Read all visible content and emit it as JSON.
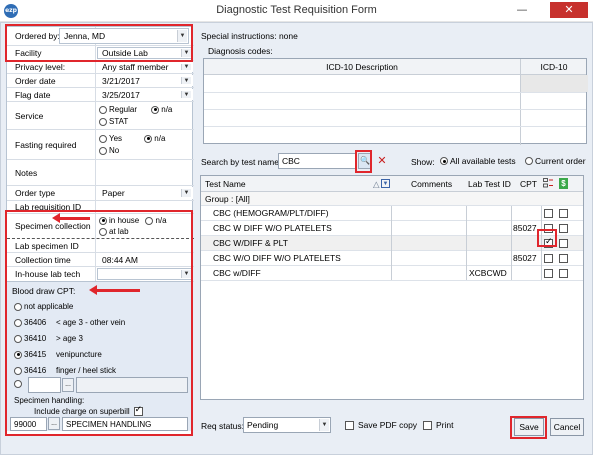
{
  "window": {
    "app_icon": "ezp",
    "title": "Diagnostic Test Requisition Form",
    "minimize_icon": "—",
    "close_icon": "✕"
  },
  "form": {
    "ordered_by_label": "Ordered by:",
    "ordered_by_value": "Jenna, MD",
    "facility_label": "Facility",
    "facility_value": "Outside Lab",
    "privacy_label": "Privacy level:",
    "privacy_value": "Any staff member",
    "order_date_label": "Order date",
    "order_date_value": "3/21/2017",
    "flag_date_label": "Flag date",
    "flag_date_value": "3/25/2017",
    "service_label": "Service",
    "service_options": [
      "Regular",
      "n/a",
      "STAT"
    ],
    "fasting_label": "Fasting required",
    "fasting_options": [
      "Yes",
      "n/a",
      "No"
    ],
    "notes_label": "Notes",
    "order_type_label": "Order type",
    "order_type_value": "Paper",
    "lab_req_label": "Lab requisition ID",
    "specimen_collection_label": "Specimen collection",
    "specimen_options": [
      "in house",
      "n/a",
      "at lab"
    ],
    "lab_specimen_label": "Lab specimen ID",
    "collection_time_label": "Collection time",
    "collection_time_value": "08:44 AM",
    "inhouse_tech_label": "In-house lab tech",
    "ellipsis": "..."
  },
  "blood_draw": {
    "title": "Blood draw CPT:",
    "options": [
      {
        "code": "not applicable",
        "desc": ""
      },
      {
        "code": "36406",
        "desc": "< age 3 - other vein"
      },
      {
        "code": "36410",
        "desc": "> age 3"
      },
      {
        "code": "36415",
        "desc": "venipuncture"
      },
      {
        "code": "36416",
        "desc": "finger / heel stick"
      }
    ],
    "specimen_handling_label": "Specimen handling:",
    "include_charge_label": "Include charge on superbill",
    "handling_code": "99000",
    "handling_desc": "SPECIMEN HANDLING"
  },
  "right": {
    "special_instructions": "Special instructions: none",
    "diagnosis_codes_label": "Diagnosis codes:",
    "icd_desc_header": "ICD-10 Description",
    "icd_header": "ICD-10"
  },
  "search": {
    "label": "Search by test name:",
    "value": "CBC",
    "search_icon": "🔍",
    "clear_icon": "✕",
    "show_label": "Show:",
    "show_all": "All available tests",
    "show_current": "Current order"
  },
  "results": {
    "headers": {
      "test_name": "Test Name",
      "sort_mark": "△",
      "comments": "Comments",
      "lab_test_id": "Lab Test ID",
      "cpt": "CPT"
    },
    "group_label": "Group : [All]",
    "rows": [
      {
        "name": "CBC (HEMOGRAM/PLT/DIFF)",
        "lab_test_id": "",
        "cpt": "",
        "checked": false
      },
      {
        "name": "CBC W DIFF W/O PLATELETS",
        "lab_test_id": "",
        "cpt": "85027",
        "checked": false
      },
      {
        "name": "CBC W/DIFF & PLT",
        "lab_test_id": "",
        "cpt": "",
        "checked": true
      },
      {
        "name": "CBC W/O DIFF W/O PLATELETS",
        "lab_test_id": "",
        "cpt": "85027",
        "checked": false
      },
      {
        "name": "CBC w/DIFF",
        "lab_test_id": "XCBCWD",
        "cpt": "",
        "checked": false
      }
    ]
  },
  "bottom": {
    "req_status_label": "Req status:",
    "req_status_value": "Pending",
    "save_pdf_label": "Save PDF copy",
    "print_label": "Print",
    "save_button": "Save",
    "cancel_button": "Cancel"
  },
  "colors": {
    "highlight": "#e0262c",
    "panel_bg": "#e3eaf4",
    "frame_bg": "#e9eef5"
  }
}
